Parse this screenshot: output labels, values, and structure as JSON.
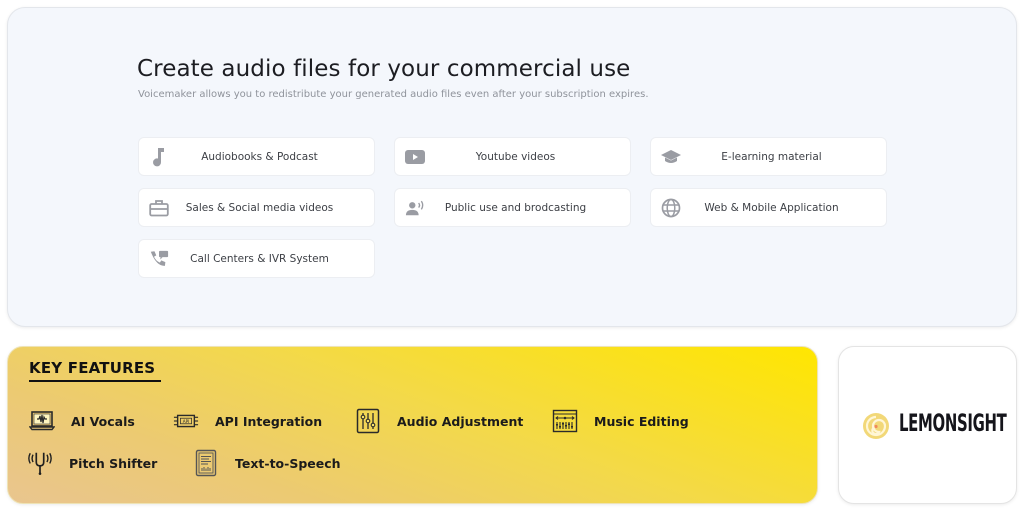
{
  "commercial_section": {
    "title": "Create audio files for your commercial use",
    "subtitle": "Voicemaker allows you to redistribute your generated audio files even after your subscription expires.",
    "use_cases": [
      {
        "label": "Audiobooks & Podcast",
        "icon": "music-note-icon"
      },
      {
        "label": "Youtube videos",
        "icon": "youtube-icon"
      },
      {
        "label": "E-learning material",
        "icon": "graduation-cap-icon"
      },
      {
        "label": "Sales & Social media videos",
        "icon": "briefcase-icon"
      },
      {
        "label": "Public use and brodcasting",
        "icon": "broadcast-user-icon"
      },
      {
        "label": "Web & Mobile Application",
        "icon": "globe-icon"
      },
      {
        "label": "Call Centers & IVR System",
        "icon": "phone-message-icon"
      }
    ],
    "icon_color": "#9a9ca3"
  },
  "key_features": {
    "title": "KEY FEATURES",
    "items": [
      {
        "label": "AI Vocals",
        "icon": "laptop-waveform-icon"
      },
      {
        "label": "API Integration",
        "icon": "api-chip-icon"
      },
      {
        "label": "Audio Adjustment",
        "icon": "sliders-icon"
      },
      {
        "label": "Music Editing",
        "icon": "music-editor-icon"
      },
      {
        "label": "Pitch Shifter",
        "icon": "tuning-fork-icon"
      },
      {
        "label": "Text-to-Speech",
        "icon": "document-audio-icon"
      }
    ],
    "gradient_colors": [
      "#e9c58f",
      "#ffe600"
    ]
  },
  "brand": {
    "name": "LEMONSIGHT",
    "logo_color": "#f0d26a"
  }
}
